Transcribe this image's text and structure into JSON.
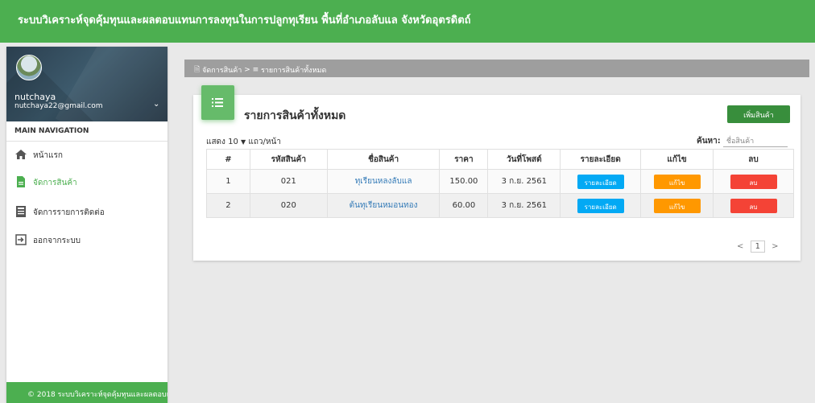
{
  "header": {
    "title": "ระบบวิเคราะห์จุดคุ้มทุนและผลตอบแทนการลงทุนในการปลูกทุเรียน พื้นที่อำเภอลับแล จังหวัดอุตรดิตถ์"
  },
  "user": {
    "name": "nutchaya",
    "email": "nutchaya22@gmail.com"
  },
  "nav": {
    "header": "MAIN NAVIGATION",
    "items": [
      {
        "label": "หน้าแรก",
        "icon": "home-icon"
      },
      {
        "label": "จัดการสินค้า",
        "icon": "file-icon",
        "active": true
      },
      {
        "label": "จัดการรายการติดต่อ",
        "icon": "contacts-icon"
      },
      {
        "label": "ออกจากระบบ",
        "icon": "logout-icon"
      }
    ]
  },
  "footer": "© 2018 ระบบวิเคราะห์จุดคุ้มทุนและผลตอบแ",
  "breadcrumb": {
    "parent": "จัดการสินค้า",
    "separator": ">",
    "current": "รายการสินค้าทั้งหมด"
  },
  "card": {
    "title": "รายการสินค้าทั้งหมด",
    "add_button": "เพิ่มสินค้า"
  },
  "table_controls": {
    "show_label": "แสดง",
    "page_length": "10",
    "per_page_label": "แถว/หน้า",
    "search_label": "ค้นหา:",
    "search_placeholder": "ชื่อสินค้า"
  },
  "table": {
    "headers": [
      "#",
      "รหัสสินค้า",
      "ชื่อสินค้า",
      "ราคา",
      "วันที่โพสต์",
      "รายละเอียด",
      "แก้ไข",
      "ลบ"
    ],
    "rows": [
      {
        "no": "1",
        "code": "021",
        "name": "ทุเรียนหลงลับแล",
        "price": "150.00",
        "date": "3 ก.ย. 2561",
        "detail": "รายละเอียด",
        "edit": "แก้ไข",
        "delete": "ลบ"
      },
      {
        "no": "2",
        "code": "020",
        "name": "ต้นทุเรียนหมอนทอง",
        "price": "60.00",
        "date": "3 ก.ย. 2561",
        "detail": "รายละเอียด",
        "edit": "แก้ไข",
        "delete": "ลบ"
      }
    ]
  },
  "pagination": {
    "prev": "<",
    "current_page": "1",
    "next": ">"
  },
  "colors": {
    "primary": "#4caf50",
    "info": "#03a9f4",
    "warning": "#ff9800",
    "danger": "#f44336"
  }
}
